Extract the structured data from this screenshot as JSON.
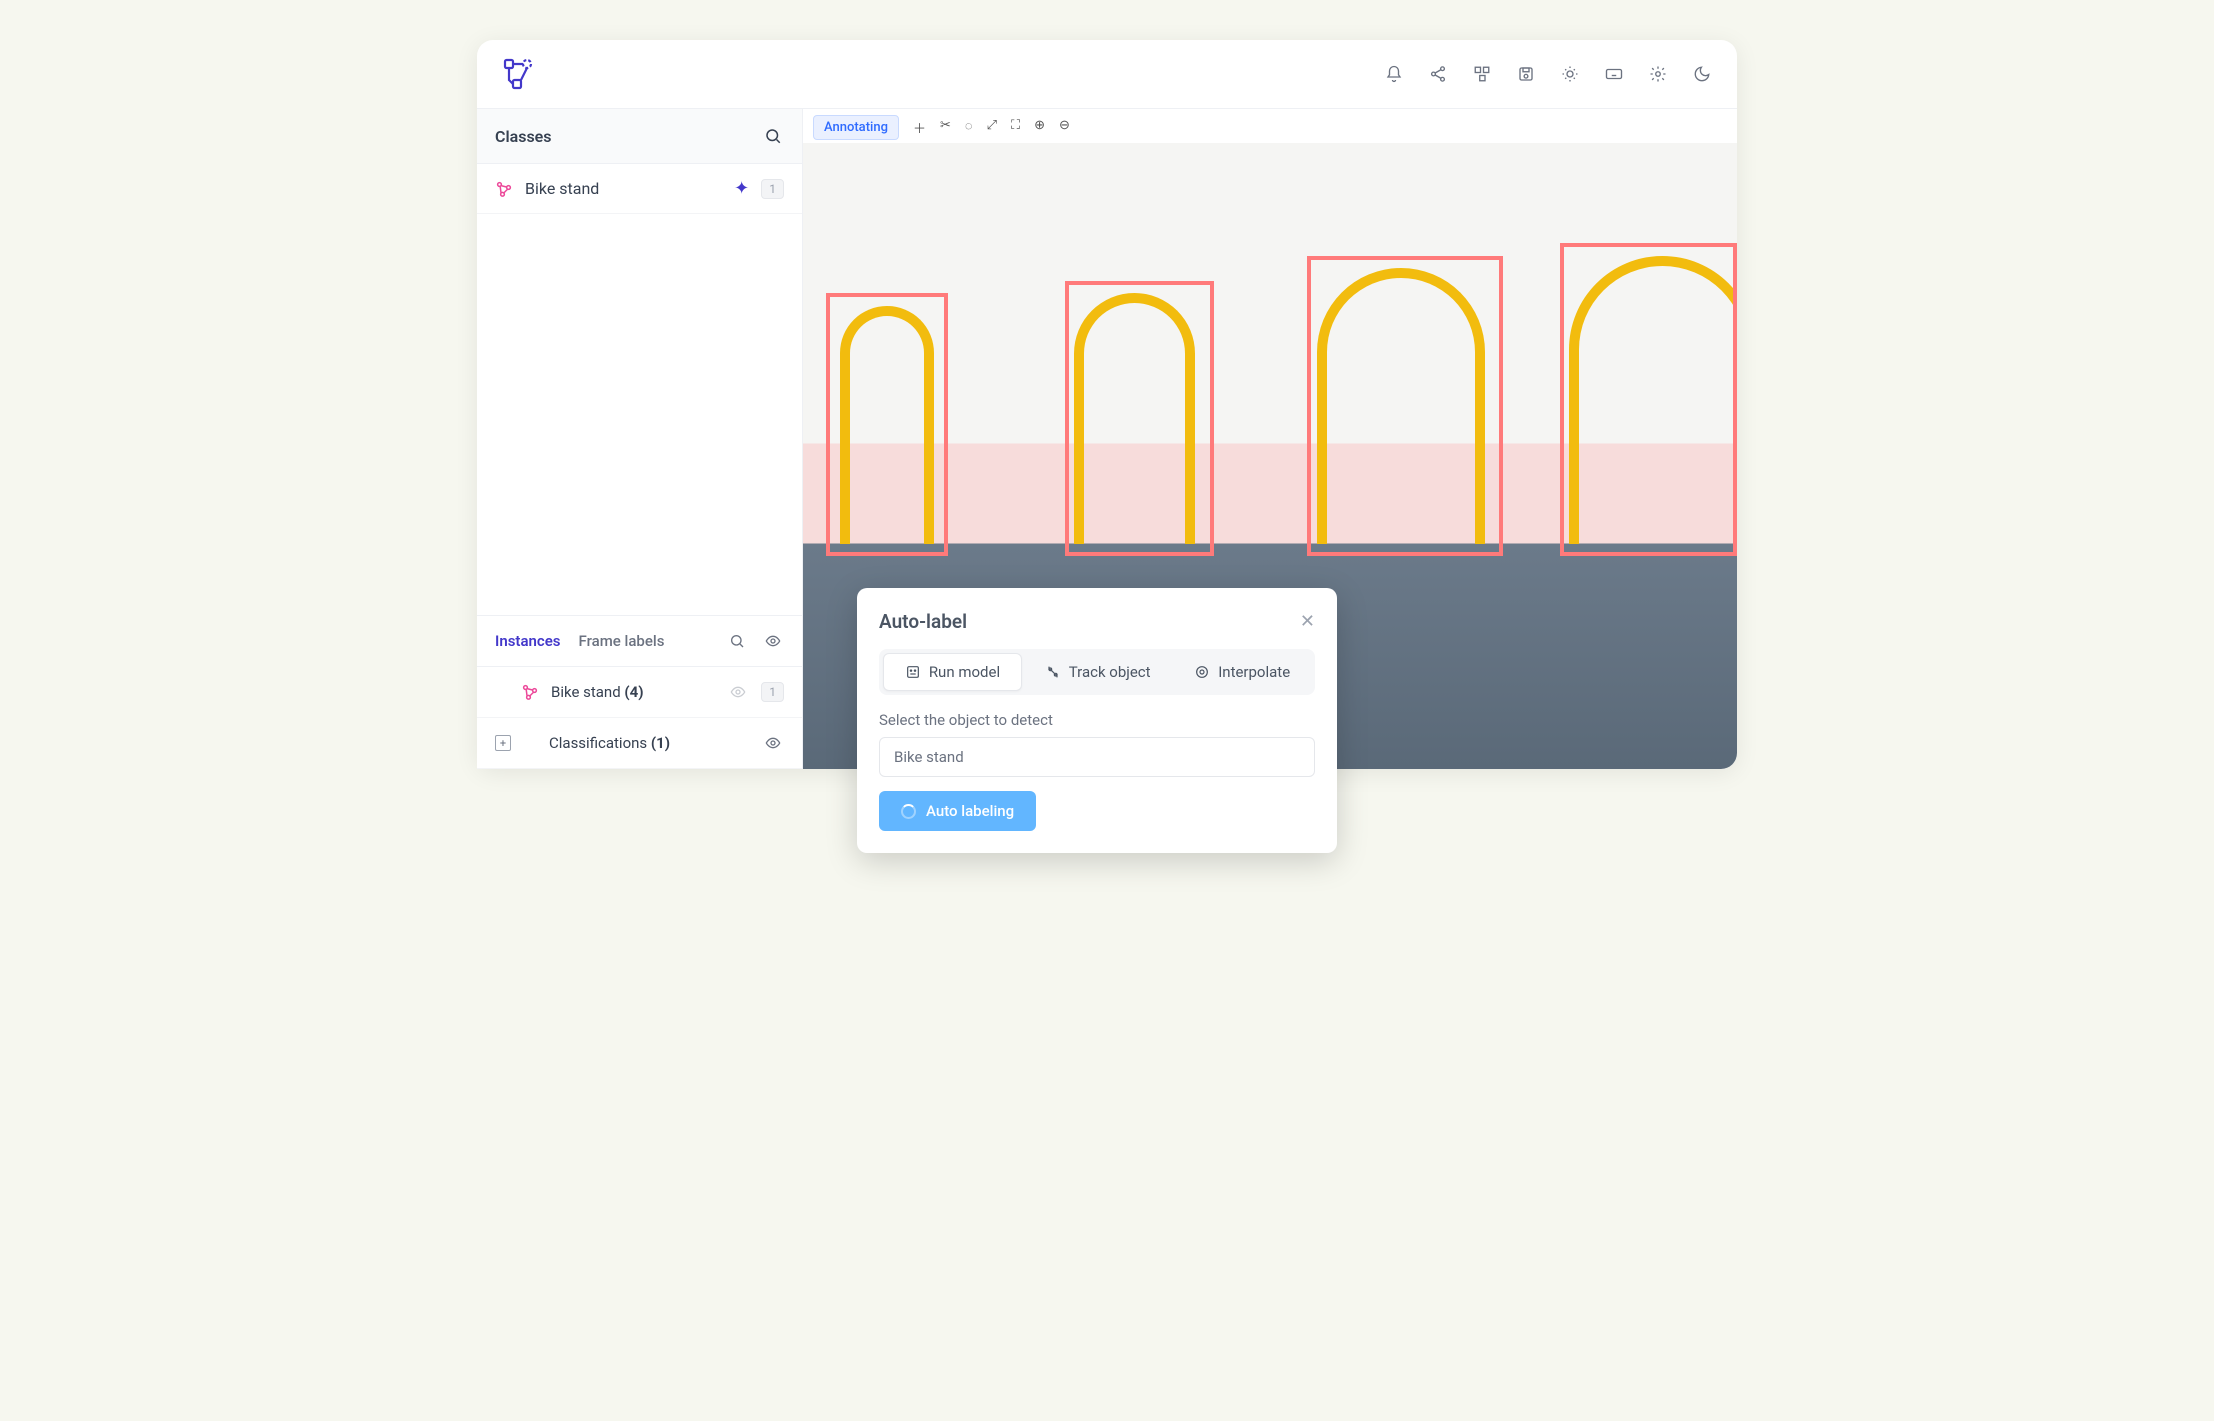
{
  "sidebar": {
    "classes_header": "Classes",
    "class": {
      "name": "Bike stand",
      "count": "1"
    },
    "tabs": {
      "instances": "Instances",
      "frame_labels": "Frame labels"
    },
    "instance": {
      "label": "Bike stand",
      "count": "(4)",
      "badge": "1"
    },
    "classifications": {
      "label": "Classifications",
      "count": "(1)"
    }
  },
  "canvas": {
    "chip": "Annotating"
  },
  "popup": {
    "title": "Auto-label",
    "tabs": {
      "run_model": "Run model",
      "track_object": "Track object",
      "interpolate": "Interpolate"
    },
    "select_label": "Select the object to detect",
    "select_value": "Bike stand",
    "button": "Auto labeling"
  }
}
